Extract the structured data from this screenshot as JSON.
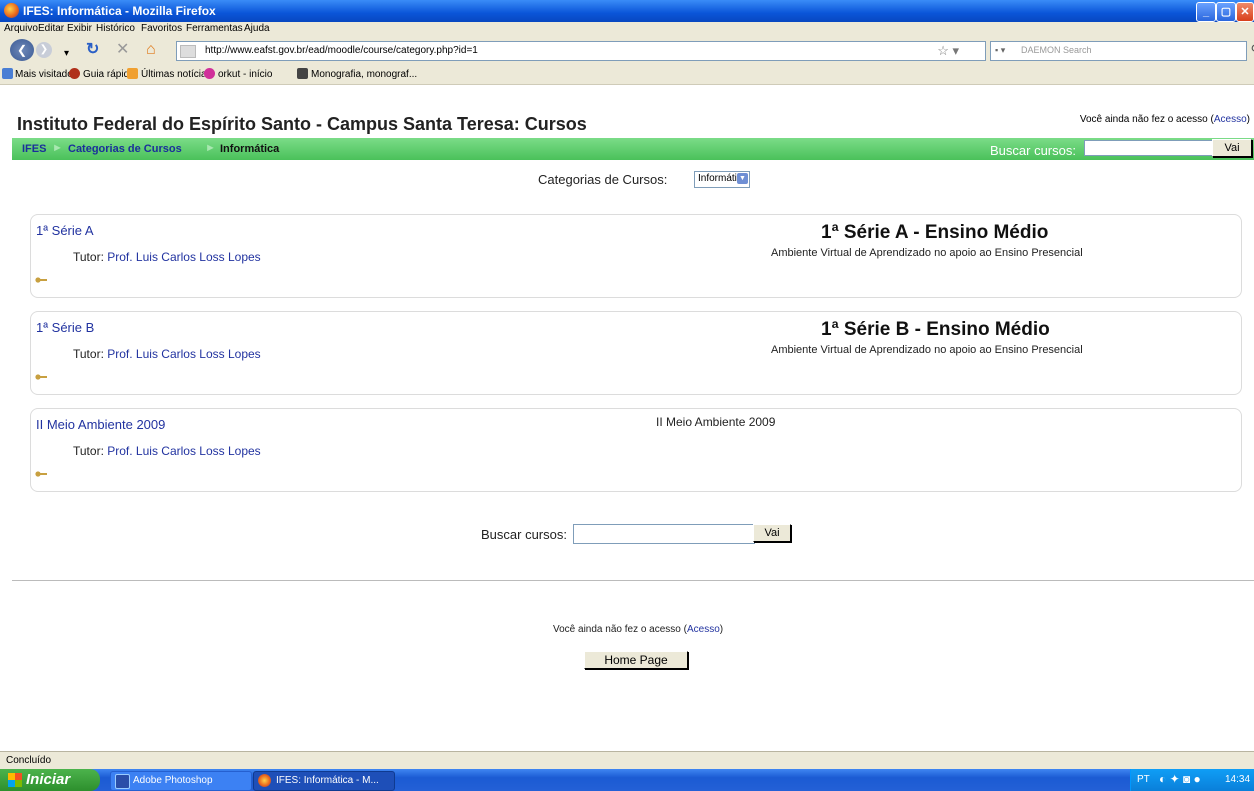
{
  "window": {
    "title": "IFES: Informática - Mozilla Firefox"
  },
  "menu": [
    "Arquivo",
    "Editar",
    "Exibir",
    "Histórico",
    "Favoritos",
    "Ferramentas",
    "Ajuda"
  ],
  "nav": {
    "url": "http://www.eafst.gov.br/ead/moodle/course/category.php?id=1",
    "search_placeholder": "DAEMON Search"
  },
  "bookmarks": [
    "Mais visitados",
    "Guia rápido",
    "Últimas notícias",
    "orkut - início",
    "Monografia, monograf..."
  ],
  "page": {
    "title": "Instituto Federal do Espírito Santo - Campus Santa Teresa: Cursos",
    "login_text": "Você ainda não fez o acesso (",
    "login_link": "Acesso",
    "login_close": ")",
    "breadcrumb": [
      "IFES",
      "Categorias de Cursos",
      "Informática"
    ],
    "search_label": "Buscar cursos:",
    "search_button": "Vai",
    "category_label": "Categorias de Cursos:",
    "category_selected": "Informática",
    "courses": [
      {
        "name": "1ª Série A",
        "tutor_label": "Tutor:",
        "tutor": "Prof. Luis Carlos Loss Lopes",
        "summary_title": "1ª Série A - Ensino Médio",
        "summary_text": "Ambiente Virtual de Aprendizado no apoio ao Ensino Presencial"
      },
      {
        "name": "1ª Série B",
        "tutor_label": "Tutor:",
        "tutor": "Prof. Luis Carlos Loss Lopes",
        "summary_title": "1ª Série B - Ensino Médio",
        "summary_text": "Ambiente Virtual de Aprendizado no apoio ao Ensino Presencial"
      },
      {
        "name": "II Meio Ambiente 2009",
        "tutor_label": "Tutor:",
        "tutor": "Prof. Luis Carlos Loss Lopes",
        "summary_plain": "II Meio Ambiente 2009"
      }
    ],
    "home_button": "Home Page"
  },
  "status": "Concluído",
  "taskbar": {
    "start": "Iniciar",
    "tasks": [
      "Adobe Photoshop",
      "IFES: Informática - M..."
    ],
    "lang": "PT",
    "clock": "14:34"
  }
}
